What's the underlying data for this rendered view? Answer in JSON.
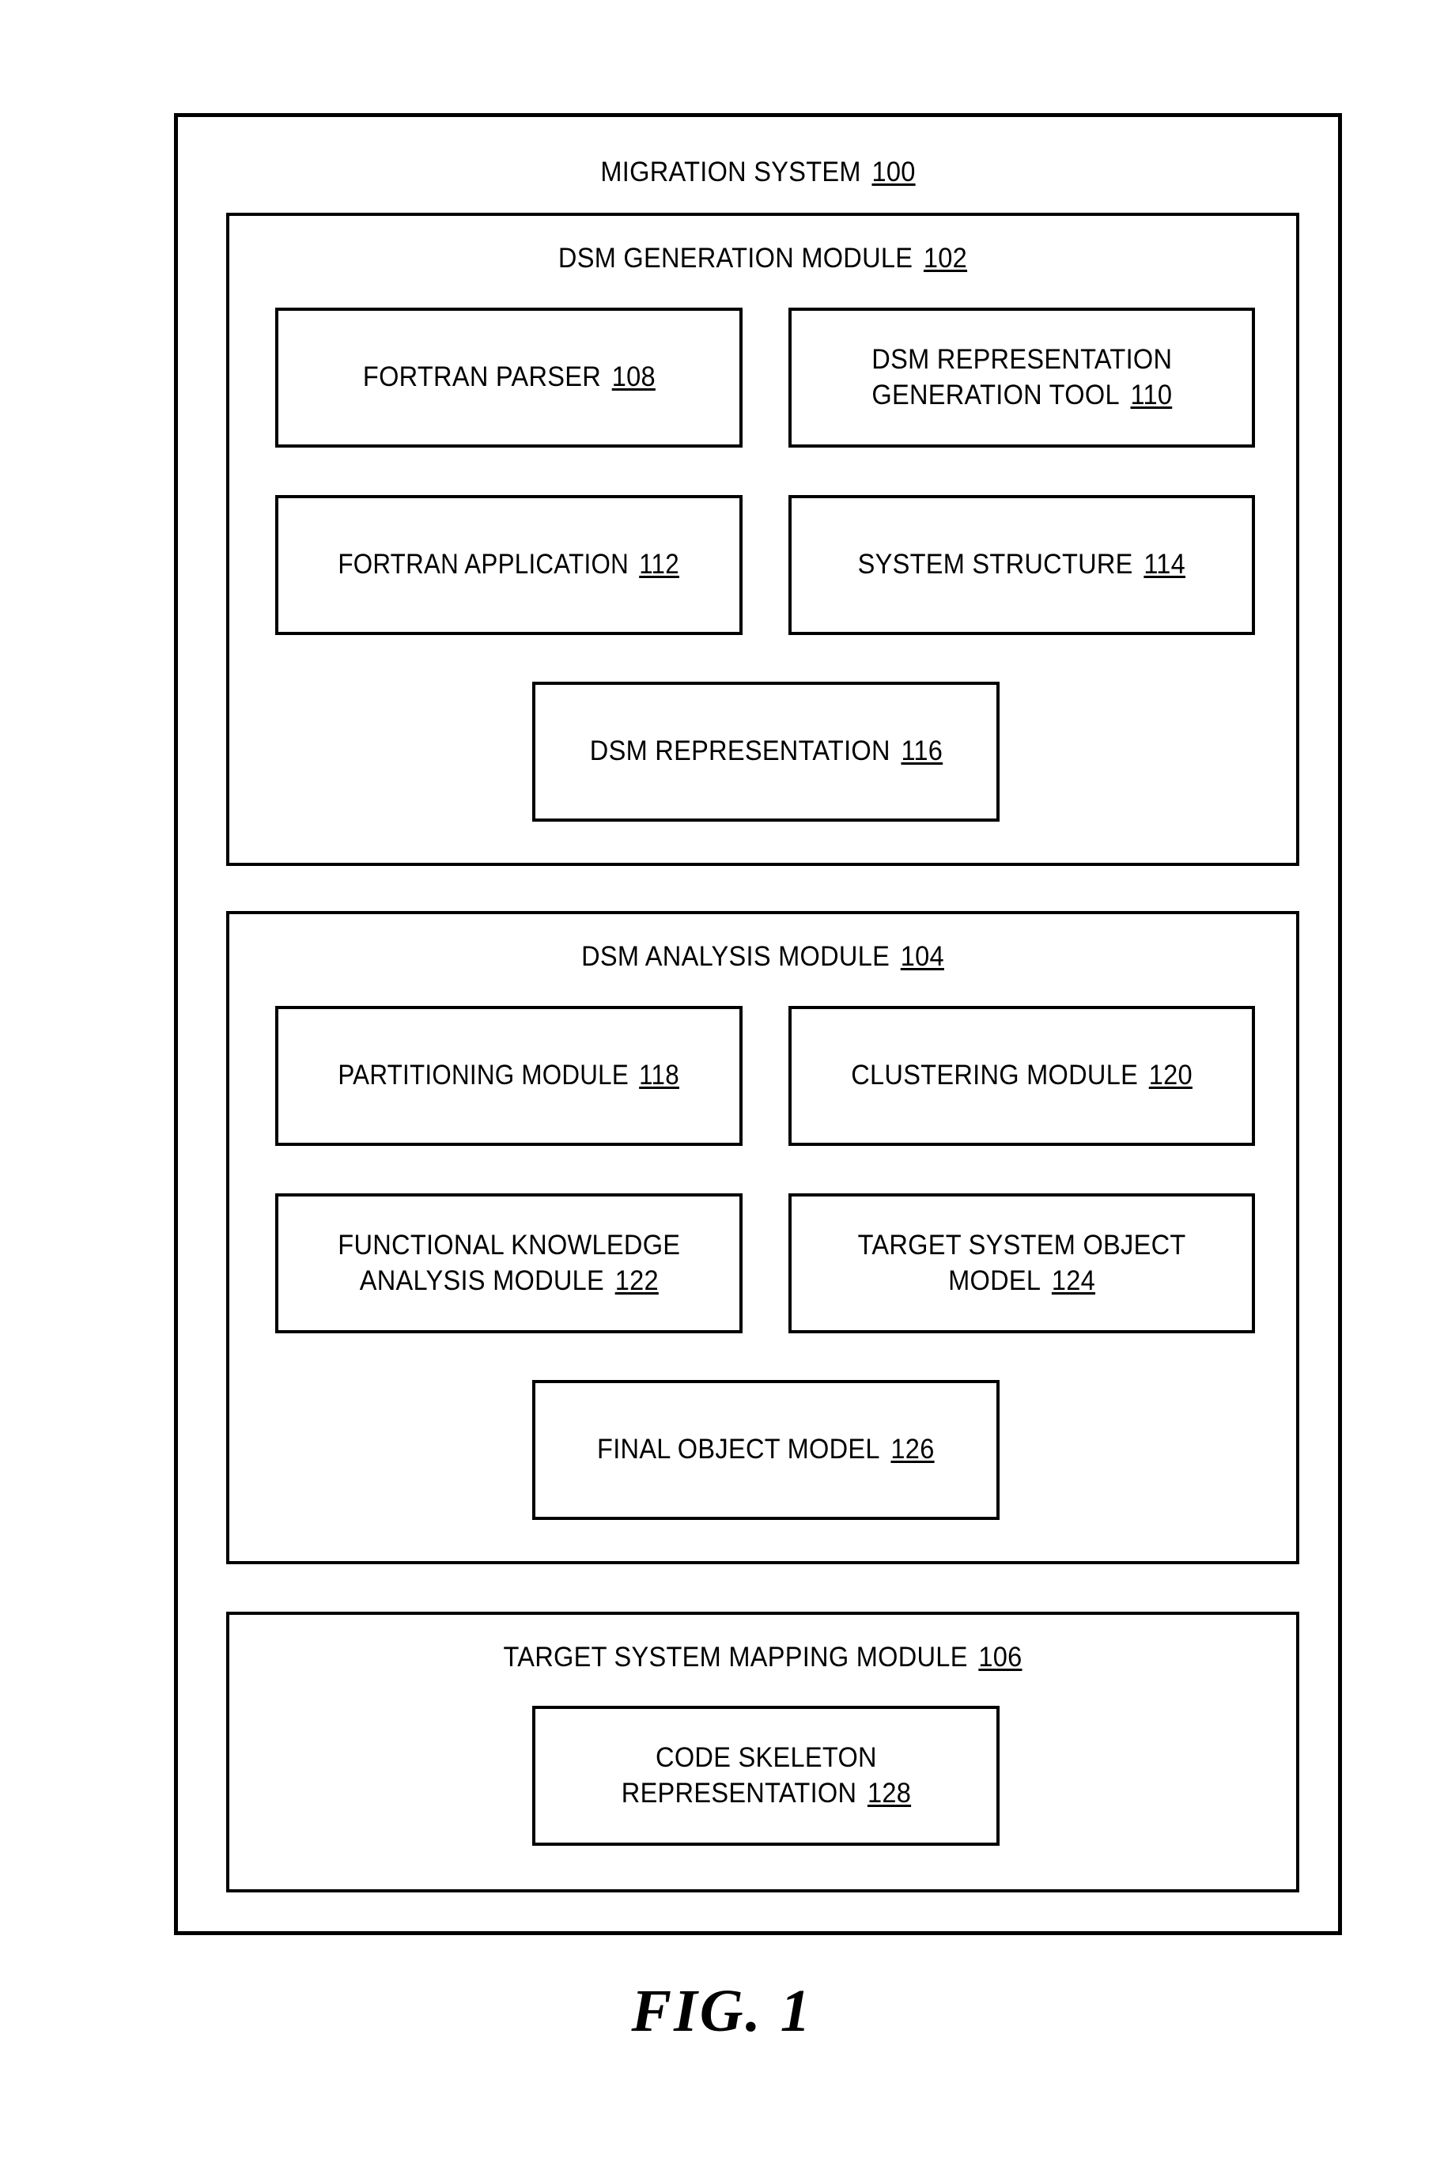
{
  "figure": {
    "caption": "FIG. 1"
  },
  "outer": {
    "title_text": "MIGRATION SYSTEM",
    "title_ref": "100"
  },
  "modules": [
    {
      "name": "dsm-generation-module",
      "title_text": "DSM GENERATION MODULE",
      "title_ref": "102",
      "cells": [
        {
          "name": "fortran-parser",
          "line1": "FORTRAN PARSER",
          "line2": "",
          "ref": "108"
        },
        {
          "name": "dsm-representation-generation-tool",
          "line1": "DSM REPRESENTATION",
          "line2": "GENERATION TOOL",
          "ref": "110"
        },
        {
          "name": "fortran-application",
          "line1": "FORTRAN APPLICATION",
          "line2": "",
          "ref": "112"
        },
        {
          "name": "system-structure",
          "line1": "SYSTEM STRUCTURE",
          "line2": "",
          "ref": "114"
        },
        {
          "name": "dsm-representation",
          "line1": "DSM REPRESENTATION",
          "line2": "",
          "ref": "116"
        }
      ]
    },
    {
      "name": "dsm-analysis-module",
      "title_text": "DSM ANALYSIS MODULE",
      "title_ref": "104",
      "cells": [
        {
          "name": "partitioning-module",
          "line1": "PARTITIONING MODULE",
          "line2": "",
          "ref": "118"
        },
        {
          "name": "clustering-module",
          "line1": "CLUSTERING MODULE",
          "line2": "",
          "ref": "120"
        },
        {
          "name": "functional-knowledge-analysis-module",
          "line1": "FUNCTIONAL KNOWLEDGE",
          "line2": "ANALYSIS MODULE",
          "ref": "122"
        },
        {
          "name": "target-system-object-model",
          "line1": "TARGET SYSTEM OBJECT",
          "line2": "MODEL",
          "ref": "124"
        },
        {
          "name": "final-object-model",
          "line1": "FINAL OBJECT MODEL",
          "line2": "",
          "ref": "126"
        }
      ]
    },
    {
      "name": "target-system-mapping-module",
      "title_text": "TARGET SYSTEM MAPPING MODULE",
      "title_ref": "106",
      "cells": [
        {
          "name": "code-skeleton-representation",
          "line1": "CODE SKELETON",
          "line2": "REPRESENTATION",
          "ref": "128"
        }
      ]
    }
  ],
  "colors": {
    "stroke": "#000000",
    "background": "#ffffff"
  }
}
